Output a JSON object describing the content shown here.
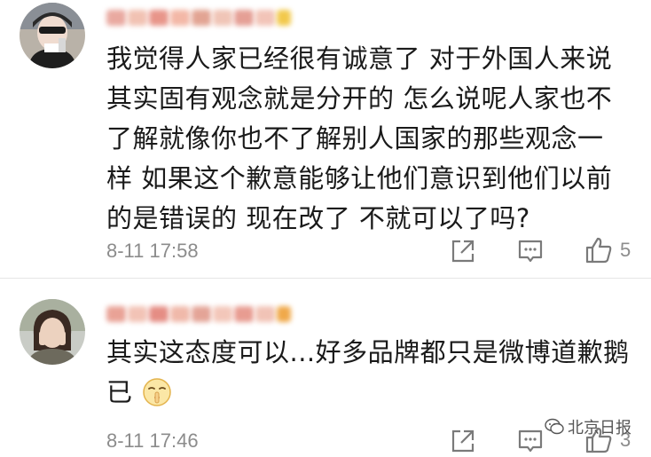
{
  "comments": [
    {
      "timestamp": "8-11 17:58",
      "lines": [
        "我觉得人家已经很有诚意了 对于外国人来说",
        "其实固有观念就是分开的 怎么说呢人家也不",
        "了解就像你也不了解别人国家的那些观念一",
        "样 如果这个歉意能够让他们意识到他们以前",
        "的是错误的 现在改了 不就可以了吗?"
      ],
      "likes": "5"
    },
    {
      "timestamp": "8-11 17:46",
      "lines": [
        "其实这态度可以...好多品牌都只是微博道歉鹅",
        "已"
      ],
      "likes": "3"
    }
  ],
  "watermark": "北京日报",
  "colors": {
    "text": "#1a1a1a",
    "meta": "#8c8c8c",
    "divider": "#e6e6e6"
  },
  "icons": [
    "forward-icon",
    "comment-icon",
    "thumbs-up-icon",
    "shush-emoji-icon",
    "wechat-icon"
  ]
}
